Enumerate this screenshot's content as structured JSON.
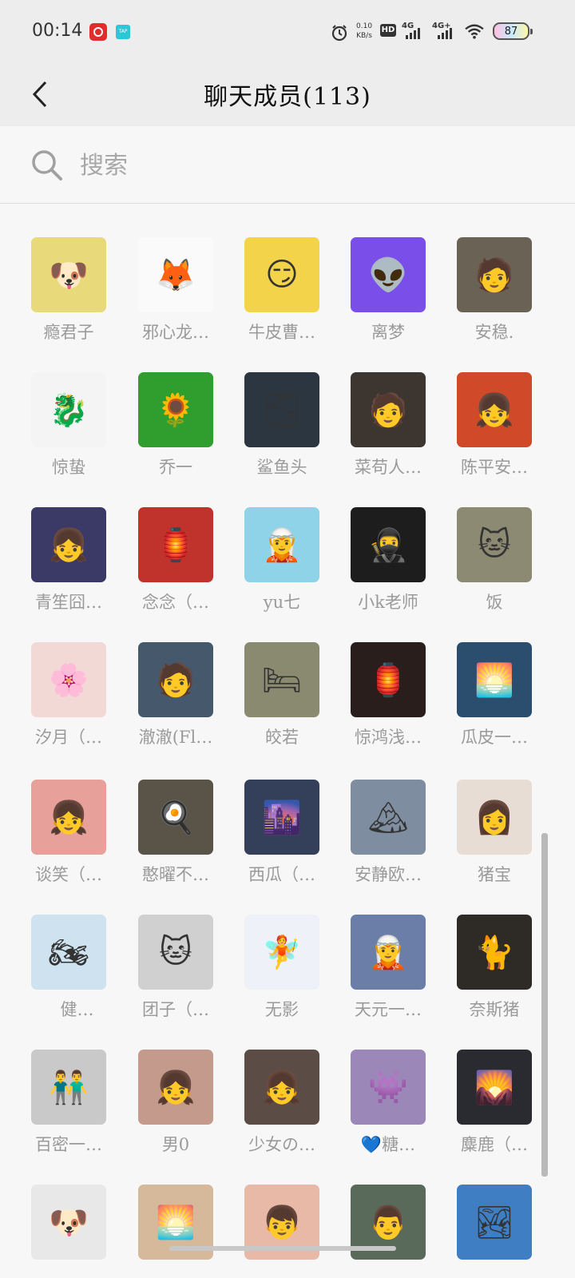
{
  "status_bar": {
    "time": "00:14",
    "app_icon_2": "TAP",
    "speed_value": "0.10",
    "speed_unit": "KB/s",
    "hd": "HD",
    "net1": "4G",
    "net2": "4G+",
    "battery": "87"
  },
  "header": {
    "title": "聊天成员(113)"
  },
  "search": {
    "placeholder": "搜索"
  },
  "members": [
    {
      "name": "瘾君子",
      "color": "#e8d97a",
      "icon": "🐶"
    },
    {
      "name": "邪心龙…",
      "color": "#fafafa",
      "icon": "🦊"
    },
    {
      "name": "牛皮曹…",
      "color": "#f3d34a",
      "icon": "😏"
    },
    {
      "name": "离梦",
      "color": "#7a4ee8",
      "icon": "👽"
    },
    {
      "name": "安稳.",
      "color": "#6b6256",
      "icon": "🧑"
    },
    {
      "name": "惊蛰",
      "color": "#f4f4f4",
      "icon": "🐉"
    },
    {
      "name": "乔一",
      "color": "#2f9e2f",
      "icon": "🌻"
    },
    {
      "name": "鲨鱼头",
      "color": "#2b3640",
      "icon": "🌫"
    },
    {
      "name": "菜苟人…",
      "color": "#3d3530",
      "icon": "🧑"
    },
    {
      "name": "陈平安…",
      "color": "#d04a2a",
      "icon": "👧"
    },
    {
      "name": "青笙囧…",
      "color": "#3b3a66",
      "icon": "👧"
    },
    {
      "name": "念念（…",
      "color": "#c0332c",
      "icon": "🏮"
    },
    {
      "name": "yu七",
      "color": "#8fd3e8",
      "icon": "🧝"
    },
    {
      "name": "小k老师",
      "color": "#1d1d1d",
      "icon": "🥷"
    },
    {
      "name": "饭",
      "color": "#8d8a73",
      "icon": "🐱"
    },
    {
      "name": "汐月（…",
      "color": "#f3d9d5",
      "icon": "🌸"
    },
    {
      "name": "澈澈(Fl…",
      "color": "#45586c",
      "icon": "🧑"
    },
    {
      "name": "皎若",
      "color": "#8a8a70",
      "icon": "🛏"
    },
    {
      "name": "惊鸿浅…",
      "color": "#2a1e1c",
      "icon": "🏮"
    },
    {
      "name": "瓜皮一…",
      "color": "#2b4e6e",
      "icon": "🌅"
    },
    {
      "name": "谈笑（…",
      "color": "#e8a09a",
      "icon": "👧"
    },
    {
      "name": "憨曜不…",
      "color": "#5a5347",
      "icon": "🍳"
    },
    {
      "name": "西瓜（…",
      "color": "#34405a",
      "icon": "🌆"
    },
    {
      "name": "安静欧…",
      "color": "#7e8ea0",
      "icon": "🏔"
    },
    {
      "name": "猪宝",
      "color": "#e8ddd4",
      "icon": "👩"
    },
    {
      "name": " 健…",
      "color": "#cfe2f0",
      "icon": "🏍"
    },
    {
      "name": "团子（…",
      "color": "#d0d0d0",
      "icon": "🐱"
    },
    {
      "name": "无影",
      "color": "#eef2f8",
      "icon": "🧚"
    },
    {
      "name": "天元一…",
      "color": "#6a7ea8",
      "icon": "🧝"
    },
    {
      "name": "奈斯猪",
      "color": "#2e2a26",
      "icon": "🐈"
    },
    {
      "name": "百密一…",
      "color": "#c9c9c9",
      "icon": "👬"
    },
    {
      "name": "男0",
      "color": "#c49a8c",
      "icon": "👧"
    },
    {
      "name": "少女の…",
      "color": "#5b4c46",
      "icon": "👧"
    },
    {
      "name": "💙糖…",
      "color": "#9b87b8",
      "icon": "👾"
    },
    {
      "name": "麋鹿（…",
      "color": "#2a2b30",
      "icon": "🌄"
    },
    {
      "name": "",
      "color": "#e8e8e8",
      "icon": "🐶"
    },
    {
      "name": "",
      "color": "#d6b89a",
      "icon": "🌅"
    },
    {
      "name": "",
      "color": "#e9b9a8",
      "icon": "👦"
    },
    {
      "name": "",
      "color": "#5a6a5a",
      "icon": "👨"
    },
    {
      "name": "",
      "color": "#3f7ec2",
      "icon": "🏞"
    }
  ]
}
